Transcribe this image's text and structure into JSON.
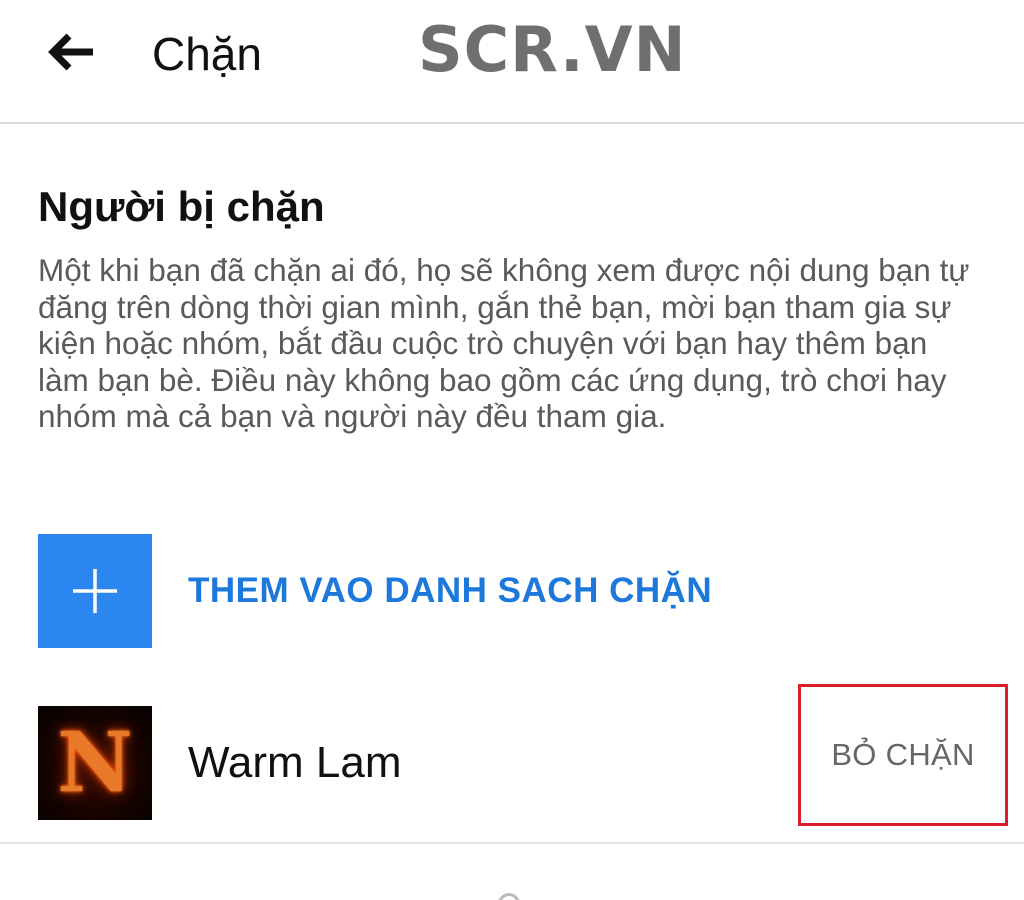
{
  "header": {
    "back_icon": "arrow-left-icon",
    "title": "Chặn",
    "watermark": "SCR.VN"
  },
  "blocked_section": {
    "title": "Người bị chặn",
    "description": "Một khi bạn đã chặn ai đó, họ sẽ không xem được nội dung bạn tự đăng trên dòng thời gian mình, gắn thẻ bạn, mời bạn tham gia sự kiện hoặc nhóm, bắt đầu cuộc trò chuyện với bạn hay thêm bạn làm bạn bè. Điều này không bao gồm các ứng dụng, trò chơi hay nhóm mà cả bạn và người này đều tham gia.",
    "add_button": {
      "icon": "plus-icon",
      "label": "THEM VAO DANH SACH CHẶN"
    },
    "blocked_users": [
      {
        "avatar_letter": "N",
        "name": "Warm Lam",
        "action_label": "BỎ CHẶN"
      }
    ]
  },
  "colors": {
    "accent_blue": "#2b86f0",
    "link_blue": "#1c78db",
    "highlight_red": "#d8202c",
    "text_primary": "#111111",
    "text_secondary": "#5a5a5a"
  }
}
